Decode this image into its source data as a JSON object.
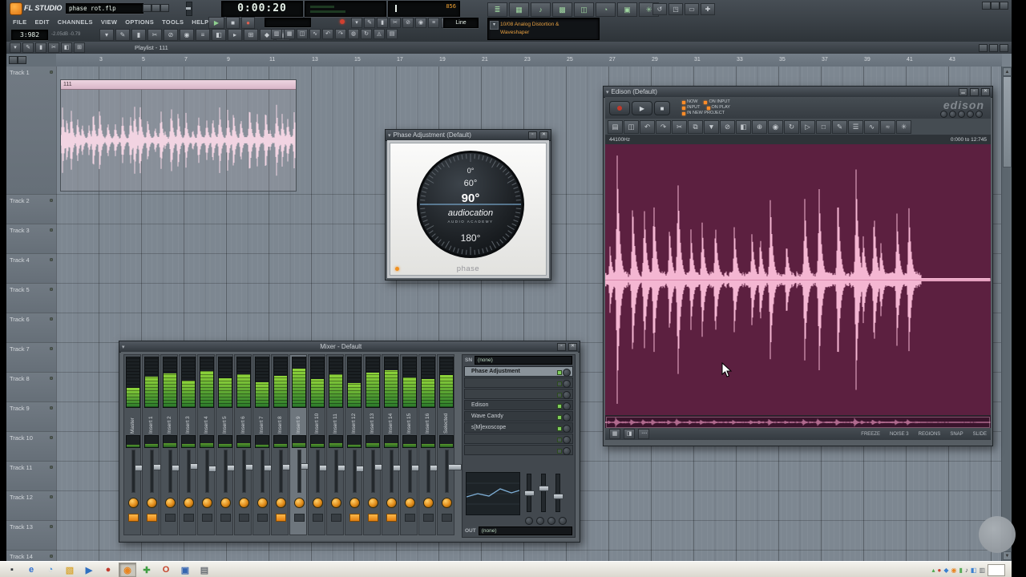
{
  "chrome": {
    "menu": "▾",
    "min": "▁",
    "max": "▫",
    "close": "✕"
  },
  "app": {
    "brand": "FL STUDIO",
    "doc_title": "phase rot.flp",
    "time_display": "0:00:20",
    "aux_display": "856",
    "position_display": "3:982",
    "level_readout": "-2.05dB   -0.79",
    "menu": [
      "FILE",
      "EDIT",
      "CHANNELS",
      "VIEW",
      "OPTIONS",
      "TOOLS",
      "HELP"
    ],
    "transport": {
      "play": "▶",
      "stop": "■",
      "record": "●"
    },
    "line_selector": "Line",
    "hint_line1": "10/08  Analog Distortion &",
    "hint_line2": "Waveshaper",
    "view_icons": [
      {
        "name": "step-seq-icon",
        "glyph": "≣"
      },
      {
        "name": "playlist-icon",
        "glyph": "▦"
      },
      {
        "name": "piano-roll-icon",
        "glyph": "♪"
      },
      {
        "name": "browser-icon",
        "glyph": "▩"
      },
      {
        "name": "mixer-icon",
        "glyph": "◫"
      },
      {
        "name": "project-info-icon",
        "glyph": "◔"
      },
      {
        "name": "plugin-picker-icon",
        "glyph": "▣"
      },
      {
        "name": "settings-icon",
        "glyph": "✳"
      }
    ],
    "extra_icons": [
      {
        "name": "refresh-icon",
        "glyph": "↺"
      },
      {
        "name": "window-icon",
        "glyph": "◳"
      },
      {
        "name": "panel-icon",
        "glyph": "▭"
      },
      {
        "name": "add-icon",
        "glyph": "✚"
      }
    ],
    "tool_icons": [
      {
        "name": "pointer-tool-icon",
        "glyph": "▾"
      },
      {
        "name": "pencil-tool-icon",
        "glyph": "✎"
      },
      {
        "name": "brush-tool-icon",
        "glyph": "▮"
      },
      {
        "name": "cut-tool-icon",
        "glyph": "✂"
      },
      {
        "name": "delete-tool-icon",
        "glyph": "⊘"
      },
      {
        "name": "mute-tool-icon",
        "glyph": "◉"
      },
      {
        "name": "slide-tool-icon",
        "glyph": "≡"
      },
      {
        "name": "zoom-tool-icon",
        "glyph": "◧"
      },
      {
        "name": "play-tool-icon",
        "glyph": "▸"
      },
      {
        "name": "snap-tool-icon",
        "glyph": "⊞"
      },
      {
        "name": "magnet-icon",
        "glyph": "◆"
      },
      {
        "name": "more-tools-icon",
        "glyph": "▤"
      }
    ],
    "snap_icons": [
      {
        "name": "grid-coarse-icon",
        "glyph": "▥"
      },
      {
        "name": "grid-fine-icon",
        "glyph": "▦"
      },
      {
        "name": "quantize-icon",
        "glyph": "◫"
      },
      {
        "name": "swing-icon",
        "glyph": "∿"
      },
      {
        "name": "undo-icon",
        "glyph": "↶"
      },
      {
        "name": "redo-icon",
        "glyph": "↷"
      },
      {
        "name": "render-icon",
        "glyph": "◍"
      },
      {
        "name": "loop-icon",
        "glyph": "↻"
      },
      {
        "name": "metronome-icon",
        "glyph": "◬"
      },
      {
        "name": "keyboard-icon",
        "glyph": "▤"
      }
    ]
  },
  "playlist": {
    "toolbar_title": "Playlist - 111",
    "tool_icons": [
      {
        "name": "pl-pointer-icon",
        "glyph": "▾"
      },
      {
        "name": "pl-pencil-icon",
        "glyph": "✎"
      },
      {
        "name": "pl-paint-icon",
        "glyph": "▮"
      },
      {
        "name": "pl-cut-icon",
        "glyph": "✂"
      },
      {
        "name": "pl-zoom-icon",
        "glyph": "◧"
      },
      {
        "name": "pl-snap-icon",
        "glyph": "⊞"
      }
    ],
    "ruler": [
      "3",
      "5",
      "7",
      "9",
      "11",
      "13",
      "15",
      "17",
      "19",
      "21",
      "23",
      "25",
      "27",
      "29",
      "31",
      "33",
      "35",
      "37",
      "39",
      "41",
      "43"
    ],
    "tracks": [
      "Track 1",
      "Track 2",
      "Track 3",
      "Track 4",
      "Track 5",
      "Track 6",
      "Track 7",
      "Track 8",
      "Track 9",
      "Track 10",
      "Track 11",
      "Track 12",
      "Track 13",
      "Track 14"
    ],
    "clip_label": "111"
  },
  "phase": {
    "title": "Phase Adjustment (Default)",
    "deg0": "0°",
    "deg60": "60°",
    "deg90": "90°",
    "deg180": "180°",
    "brand": "audiocation",
    "brand_sub": "AUDIO ACADEMY",
    "param": "phase"
  },
  "mixer": {
    "title": "Mixer - Default",
    "channels": [
      "Master",
      "Insert 1",
      "Insert 2",
      "Insert 3",
      "Insert 4",
      "Insert 5",
      "Insert 6",
      "Insert 7",
      "Insert 8",
      "Insert 9",
      "Insert 10",
      "Insert 11",
      "Insert 12",
      "Insert 13",
      "Insert 14",
      "Insert 15",
      "Insert 16",
      "Selected"
    ],
    "levels": [
      38,
      62,
      68,
      54,
      72,
      58,
      66,
      50,
      63,
      78,
      56,
      66,
      48,
      70,
      74,
      60,
      57,
      64
    ],
    "faders": [
      40,
      38,
      42,
      36,
      44,
      40,
      38,
      42,
      39,
      37,
      41,
      40,
      43,
      38,
      40,
      42,
      41,
      39
    ],
    "fx_on": [
      0,
      1,
      8,
      12,
      13,
      14
    ],
    "selected_index": 9,
    "sends_label": "SN",
    "out_label": "OUT",
    "none_value": "(none)",
    "slots": [
      "Phase Adjustment",
      "",
      "",
      "Edison",
      "Wave Candy",
      "s[M]exoscope",
      "",
      ""
    ]
  },
  "edison": {
    "title": "Edison (Default)",
    "logo": "edison",
    "opt_now": "NOW",
    "opt_on_input": "ON INPUT",
    "opt_input": "INPUT",
    "opt_on_play": "ON PLAY",
    "opt_new_project": "IN NEW PROJECT",
    "sample_rate": "44100Hz",
    "range": "0:000 to 12:745",
    "status": [
      "FREEZE",
      "NOISE 3",
      "REGIONS",
      "SNAP",
      "SLIDE"
    ],
    "toolbar": [
      {
        "name": "ed-file-icon",
        "glyph": "▤"
      },
      {
        "name": "ed-save-icon",
        "glyph": "◫"
      },
      {
        "name": "ed-undo-icon",
        "glyph": "↶"
      },
      {
        "name": "ed-redo-icon",
        "glyph": "↷"
      },
      {
        "name": "ed-cut-icon",
        "glyph": "✂"
      },
      {
        "name": "ed-copy-icon",
        "glyph": "⧉"
      },
      {
        "name": "ed-paste-icon",
        "glyph": "▼"
      },
      {
        "name": "ed-delete-icon",
        "glyph": "⊘"
      },
      {
        "name": "ed-select-icon",
        "glyph": "◧"
      },
      {
        "name": "ed-zoom-icon",
        "glyph": "⊕"
      },
      {
        "name": "ed-record-icon",
        "glyph": "◉"
      },
      {
        "name": "ed-loop-icon",
        "glyph": "↻"
      },
      {
        "name": "ed-play-icon",
        "glyph": "▷"
      },
      {
        "name": "ed-stop-icon",
        "glyph": "□"
      },
      {
        "name": "ed-draw-icon",
        "glyph": "✎"
      },
      {
        "name": "ed-regions-icon",
        "glyph": "☰"
      },
      {
        "name": "ed-denoise-icon",
        "glyph": "∿"
      },
      {
        "name": "ed-eq-icon",
        "glyph": "≈"
      },
      {
        "name": "ed-script-icon",
        "glyph": "✳"
      }
    ]
  },
  "taskbar": {
    "items": [
      {
        "name": "taskbar-app-1",
        "glyph": "▪",
        "color": "#33383d",
        "pressed": false
      },
      {
        "name": "taskbar-internet-explorer",
        "glyph": "e",
        "color": "#2e6fd0",
        "pressed": false
      },
      {
        "name": "taskbar-chrome",
        "glyph": "◔",
        "color": "#4a90d9",
        "pressed": false
      },
      {
        "name": "taskbar-folder",
        "glyph": "▧",
        "color": "#d9a93b",
        "pressed": false
      },
      {
        "name": "taskbar-media-player",
        "glyph": "▶",
        "color": "#2f6fc0",
        "pressed": false
      },
      {
        "name": "taskbar-app-red",
        "glyph": "●",
        "color": "#c23b2e",
        "pressed": false
      },
      {
        "name": "taskbar-fl-studio",
        "glyph": "◉",
        "color": "#e8841f",
        "pressed": true
      },
      {
        "name": "taskbar-app-green",
        "glyph": "✚",
        "color": "#3f9d42",
        "pressed": false
      },
      {
        "name": "taskbar-openoffice",
        "glyph": "O",
        "color": "#c6432b",
        "pressed": false
      },
      {
        "name": "taskbar-app-blue",
        "glyph": "▣",
        "color": "#3565b0",
        "pressed": false
      },
      {
        "name": "taskbar-app-gray",
        "glyph": "▤",
        "color": "#6b7076",
        "pressed": false
      }
    ],
    "tray": [
      {
        "name": "tray-icon-1",
        "glyph": "▴",
        "color": "#4aa84a"
      },
      {
        "name": "tray-icon-2",
        "glyph": "●",
        "color": "#cc4433"
      },
      {
        "name": "tray-icon-3",
        "glyph": "◆",
        "color": "#3a7fd0"
      },
      {
        "name": "tray-icon-4",
        "glyph": "◉",
        "color": "#e8841f"
      },
      {
        "name": "tray-icon-5",
        "glyph": "▮",
        "color": "#55aa55"
      },
      {
        "name": "tray-icon-6",
        "glyph": "♪",
        "color": "#444a50"
      },
      {
        "name": "tray-icon-7",
        "glyph": "◧",
        "color": "#3a7fd0"
      },
      {
        "name": "tray-icon-8",
        "glyph": "▥",
        "color": "#666c72"
      }
    ]
  }
}
